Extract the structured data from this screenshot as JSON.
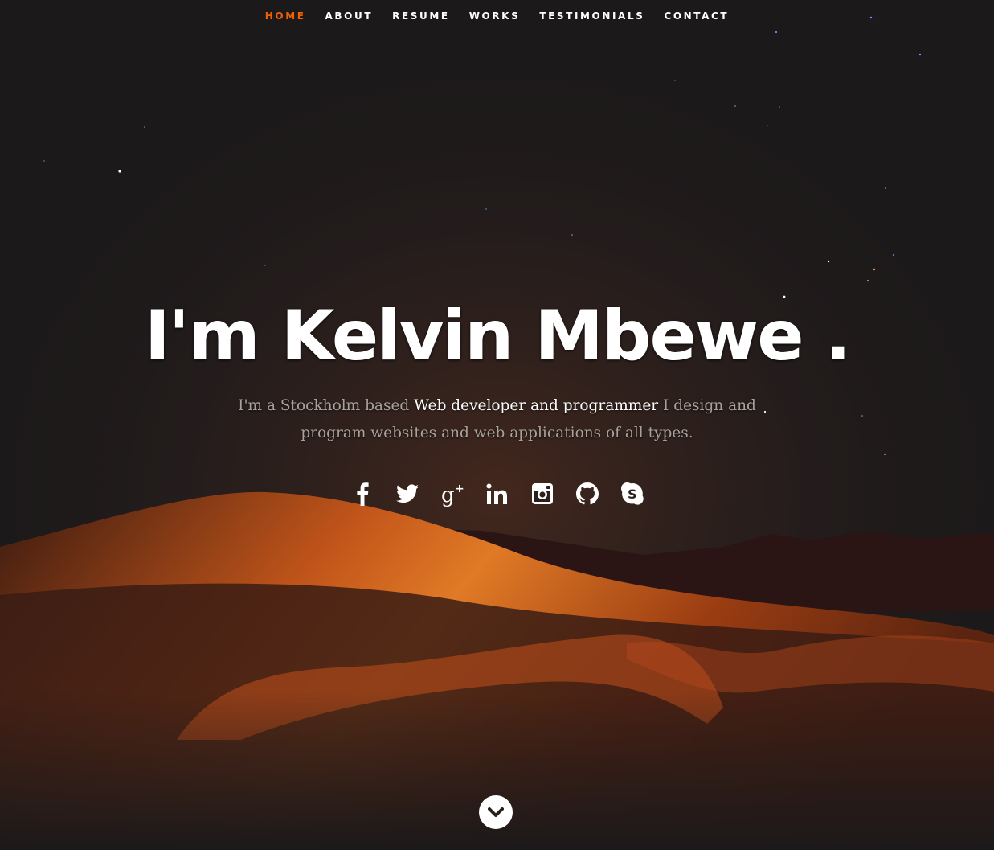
{
  "nav": {
    "items": [
      {
        "label": "HOME",
        "active": true
      },
      {
        "label": "ABOUT",
        "active": false
      },
      {
        "label": "RESUME",
        "active": false
      },
      {
        "label": "WORKS",
        "active": false
      },
      {
        "label": "TESTIMONIALS",
        "active": false
      },
      {
        "label": "CONTACT",
        "active": false
      }
    ]
  },
  "hero": {
    "headline": "I'm Kelvin Mbewe .",
    "subtitle_prefix": "I'm a Stockholm based ",
    "subtitle_highlight": "Web developer and programmer",
    "subtitle_suffix": " I design and program websites and web applications of all types."
  },
  "social": {
    "icons": [
      "facebook-icon",
      "twitter-icon",
      "google-plus-icon",
      "linkedin-icon",
      "instagram-icon",
      "github-icon",
      "skype-icon"
    ]
  },
  "scroll": {
    "icon": "chevron-down-icon"
  },
  "colors": {
    "accent": "#f06000",
    "background": "#1c191a",
    "text": "#ffffff",
    "muted_text": "#a8a29c"
  }
}
